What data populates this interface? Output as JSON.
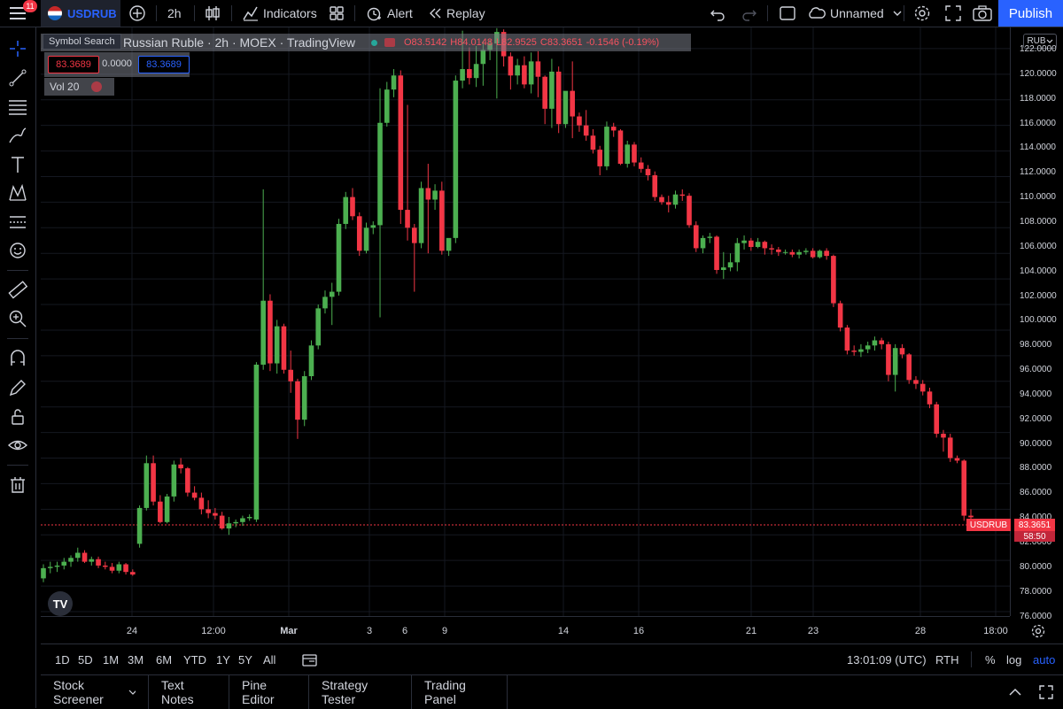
{
  "topbar": {
    "notification_count": "11",
    "symbol": "USDRUB",
    "interval": "2h",
    "indicators_label": "Indicators",
    "alert_label": "Alert",
    "replay_label": "Replay",
    "layout_name": "Unnamed",
    "publish_label": "Publish"
  },
  "tooltip": "Symbol Search",
  "legend": {
    "title": "Russian Ruble · 2h · MOEX · TradingView",
    "open": "O83.5142",
    "high": "H84.0148",
    "low": "L82.9525",
    "close": "C83.3651",
    "change": "-0.1546 (-0.19%)",
    "bid": "83.3689",
    "spread": "0.0000",
    "ask": "83.3689",
    "volume_label": "Vol 20"
  },
  "price_axis": {
    "currency": "RUB",
    "ticks": [
      "122.0000",
      "120.0000",
      "118.0000",
      "116.0000",
      "114.0000",
      "112.0000",
      "110.0000",
      "108.0000",
      "106.0000",
      "104.0000",
      "102.0000",
      "100.0000",
      "98.0000",
      "96.0000",
      "94.0000",
      "92.0000",
      "90.0000",
      "88.0000",
      "86.0000",
      "84.0000",
      "82.0000",
      "80.0000",
      "78.0000",
      "76.0000"
    ],
    "last_symbol": "USDRUB",
    "last_price": "83.3651",
    "countdown": "58:50"
  },
  "time_axis": {
    "ticks": [
      "24",
      "12:00",
      "Mar",
      "3",
      "6",
      "9",
      "14",
      "16",
      "21",
      "23",
      "28",
      "18:00"
    ]
  },
  "range_bar": {
    "ranges": [
      "1D",
      "5D",
      "1M",
      "3M",
      "6M",
      "YTD",
      "1Y",
      "5Y",
      "All"
    ],
    "clock": "13:01:09 (UTC)",
    "session": "RTH",
    "percent": "%",
    "log": "log",
    "auto": "auto"
  },
  "panels": {
    "tabs": [
      "Stock Screener",
      "Text Notes",
      "Pine Editor",
      "Strategy Tester",
      "Trading Panel"
    ]
  },
  "colors": {
    "up": "#4caf50",
    "down": "#f23645",
    "accent": "#2962ff"
  },
  "chart_data": {
    "type": "candlestick",
    "symbol": "USDRUB",
    "ylim": [
      76,
      122
    ],
    "candles": [
      [
        78.6,
        79.7,
        78.3,
        79.4
      ],
      [
        79.4,
        79.9,
        79.0,
        79.5
      ],
      [
        79.5,
        79.9,
        79.1,
        79.6
      ],
      [
        79.6,
        80.2,
        79.3,
        79.9
      ],
      [
        79.9,
        80.4,
        79.5,
        80.2
      ],
      [
        80.2,
        81.0,
        79.9,
        80.6
      ],
      [
        80.6,
        80.8,
        79.8,
        79.9
      ],
      [
        79.9,
        80.3,
        79.6,
        80.1
      ],
      [
        80.1,
        80.3,
        79.4,
        79.6
      ],
      [
        79.6,
        79.9,
        79.3,
        79.5
      ],
      [
        79.5,
        79.8,
        79.0,
        79.2
      ],
      [
        79.2,
        79.9,
        79.0,
        79.7
      ],
      [
        79.7,
        79.8,
        78.9,
        79.1
      ],
      [
        79.1,
        79.3,
        78.8,
        78.9
      ],
      [
        81.3,
        84.3,
        81.0,
        84.1
      ],
      [
        84.1,
        88.2,
        83.9,
        87.6
      ],
      [
        87.6,
        88.2,
        84.3,
        84.6
      ],
      [
        84.6,
        85.1,
        82.9,
        83.0
      ],
      [
        83.0,
        85.2,
        82.9,
        85.0
      ],
      [
        85.0,
        87.8,
        84.6,
        87.5
      ],
      [
        87.5,
        88.0,
        86.8,
        87.2
      ],
      [
        87.2,
        87.3,
        85.0,
        85.3
      ],
      [
        85.3,
        85.8,
        84.7,
        84.9
      ],
      [
        84.9,
        85.3,
        83.6,
        84.0
      ],
      [
        84.0,
        84.7,
        83.3,
        83.7
      ],
      [
        83.7,
        84.1,
        83.2,
        83.5
      ],
      [
        83.5,
        83.8,
        82.4,
        82.5
      ],
      [
        82.5,
        83.4,
        82.0,
        82.9
      ],
      [
        82.9,
        83.2,
        82.6,
        83.0
      ],
      [
        83.0,
        83.5,
        82.7,
        83.3
      ],
      [
        83.3,
        83.6,
        83.1,
        83.4
      ],
      [
        83.2,
        95.5,
        83.0,
        95.3
      ],
      [
        95.3,
        109.0,
        94.9,
        100.3
      ],
      [
        100.3,
        100.8,
        94.8,
        95.4
      ],
      [
        95.4,
        98.8,
        94.6,
        98.3
      ],
      [
        98.3,
        98.5,
        94.6,
        94.9
      ],
      [
        94.9,
        96.4,
        93.1,
        94.0
      ],
      [
        94.0,
        94.2,
        89.5,
        91.0
      ],
      [
        91.0,
        94.8,
        90.5,
        94.4
      ],
      [
        94.4,
        97.2,
        94.1,
        96.8
      ],
      [
        96.8,
        100.0,
        96.5,
        99.7
      ],
      [
        99.7,
        101.1,
        99.3,
        100.6
      ],
      [
        100.6,
        101.7,
        98.4,
        101.0
      ],
      [
        101.0,
        106.7,
        100.7,
        106.3
      ],
      [
        106.3,
        108.8,
        105.9,
        108.4
      ],
      [
        108.4,
        109.1,
        106.6,
        106.9
      ],
      [
        106.9,
        107.2,
        103.8,
        104.2
      ],
      [
        104.2,
        106.4,
        104.0,
        106.0
      ],
      [
        106.0,
        106.5,
        105.5,
        106.2
      ],
      [
        106.2,
        116.9,
        99.0,
        114.2
      ],
      [
        114.2,
        117.4,
        113.9,
        116.8
      ],
      [
        116.8,
        118.4,
        116.2,
        117.9
      ],
      [
        117.9,
        118.3,
        106.3,
        107.4
      ],
      [
        107.4,
        115.6,
        105.0,
        106.0
      ],
      [
        106.0,
        106.3,
        101.0,
        104.8
      ],
      [
        104.8,
        109.6,
        104.4,
        109.1
      ],
      [
        109.1,
        111.0,
        104.0,
        108.2
      ],
      [
        108.2,
        109.4,
        107.4,
        108.9
      ],
      [
        108.9,
        109.6,
        103.9,
        104.2
      ],
      [
        104.2,
        105.0,
        103.8,
        105.2
      ],
      [
        105.2,
        117.9,
        104.8,
        117.5
      ],
      [
        117.5,
        121.4,
        116.9,
        118.4
      ],
      [
        118.4,
        120.1,
        117.2,
        117.7
      ],
      [
        117.7,
        120.2,
        117.0,
        118.8
      ],
      [
        118.8,
        120.6,
        117.1,
        119.9
      ],
      [
        119.9,
        120.7,
        119.1,
        120.4
      ],
      [
        120.4,
        121.6,
        116.1,
        121.3
      ],
      [
        121.3,
        121.5,
        118.6,
        119.4
      ],
      [
        119.4,
        119.7,
        116.8,
        117.9
      ],
      [
        117.9,
        119.2,
        117.2,
        118.7
      ],
      [
        118.7,
        119.4,
        116.9,
        117.2
      ],
      [
        117.2,
        119.7,
        116.5,
        119.0
      ],
      [
        119.0,
        119.8,
        116.2,
        117.8
      ],
      [
        117.8,
        117.9,
        114.1,
        115.3
      ],
      [
        115.3,
        119.2,
        113.8,
        118.2
      ],
      [
        118.2,
        118.6,
        113.4,
        114.1
      ],
      [
        114.1,
        115.9,
        113.8,
        116.7
      ],
      [
        116.7,
        119.0,
        113.0,
        114.7
      ],
      [
        114.7,
        115.0,
        113.5,
        114.0
      ],
      [
        114.0,
        115.2,
        112.8,
        113.2
      ],
      [
        113.2,
        113.7,
        111.8,
        112.1
      ],
      [
        112.1,
        112.4,
        110.1,
        110.8
      ],
      [
        110.8,
        114.3,
        110.5,
        113.9
      ],
      [
        113.9,
        114.2,
        113.1,
        113.6
      ],
      [
        113.6,
        113.7,
        110.9,
        111.0
      ],
      [
        111.0,
        112.8,
        110.7,
        112.5
      ],
      [
        112.5,
        112.7,
        110.8,
        111.1
      ],
      [
        111.1,
        111.5,
        110.3,
        110.6
      ],
      [
        110.6,
        110.9,
        109.7,
        110.1
      ],
      [
        110.1,
        110.4,
        108.1,
        108.4
      ],
      [
        108.4,
        108.6,
        107.8,
        108.0
      ],
      [
        108.0,
        108.5,
        107.2,
        107.8
      ],
      [
        107.8,
        108.9,
        107.5,
        108.6
      ],
      [
        108.6,
        109.0,
        108.1,
        108.5
      ],
      [
        108.5,
        108.7,
        106.0,
        106.2
      ],
      [
        106.2,
        106.5,
        104.1,
        104.4
      ],
      [
        104.4,
        105.4,
        104.0,
        105.2
      ],
      [
        105.2,
        105.6,
        104.8,
        105.3
      ],
      [
        105.3,
        105.4,
        102.4,
        102.7
      ],
      [
        102.7,
        104.1,
        102.0,
        102.9
      ],
      [
        102.9,
        104.0,
        102.6,
        103.3
      ],
      [
        103.3,
        105.2,
        102.6,
        104.8
      ],
      [
        104.8,
        105.4,
        104.3,
        105.0
      ],
      [
        105.0,
        105.2,
        104.2,
        104.5
      ],
      [
        104.5,
        105.2,
        104.4,
        104.9
      ],
      [
        104.9,
        105.0,
        103.9,
        104.4
      ],
      [
        104.4,
        104.7,
        103.9,
        104.3
      ],
      [
        104.3,
        104.5,
        103.8,
        104.1
      ],
      [
        104.1,
        104.3,
        103.9,
        104.1
      ],
      [
        104.1,
        104.3,
        103.7,
        103.9
      ],
      [
        103.9,
        104.3,
        103.6,
        104.1
      ],
      [
        104.1,
        104.4,
        103.9,
        104.2
      ],
      [
        104.2,
        104.4,
        103.6,
        103.7
      ],
      [
        103.7,
        104.3,
        103.6,
        104.2
      ],
      [
        104.2,
        104.4,
        103.5,
        103.8
      ],
      [
        103.8,
        103.9,
        99.8,
        100.1
      ],
      [
        100.1,
        100.3,
        97.9,
        98.2
      ],
      [
        98.2,
        98.4,
        96.1,
        96.4
      ],
      [
        96.4,
        96.8,
        96.0,
        96.3
      ],
      [
        96.3,
        96.9,
        95.9,
        96.5
      ],
      [
        96.5,
        97.1,
        96.2,
        96.8
      ],
      [
        96.8,
        97.5,
        96.4,
        97.2
      ],
      [
        97.2,
        97.4,
        96.5,
        96.9
      ],
      [
        96.9,
        97.1,
        94.0,
        94.5
      ],
      [
        94.5,
        96.9,
        93.2,
        96.6
      ],
      [
        96.6,
        96.9,
        95.8,
        96.1
      ],
      [
        96.1,
        96.2,
        93.8,
        94.1
      ],
      [
        94.1,
        94.4,
        93.4,
        93.8
      ],
      [
        93.8,
        94.1,
        92.9,
        93.2
      ],
      [
        93.2,
        93.5,
        91.9,
        92.2
      ],
      [
        92.2,
        92.4,
        89.6,
        89.9
      ],
      [
        89.9,
        90.2,
        88.5,
        89.6
      ],
      [
        89.6,
        89.9,
        87.7,
        88.0
      ],
      [
        88.0,
        88.2,
        87.6,
        87.8
      ],
      [
        87.8,
        87.9,
        83.1,
        83.5
      ],
      [
        83.5,
        84.0,
        82.95,
        83.37
      ]
    ]
  }
}
